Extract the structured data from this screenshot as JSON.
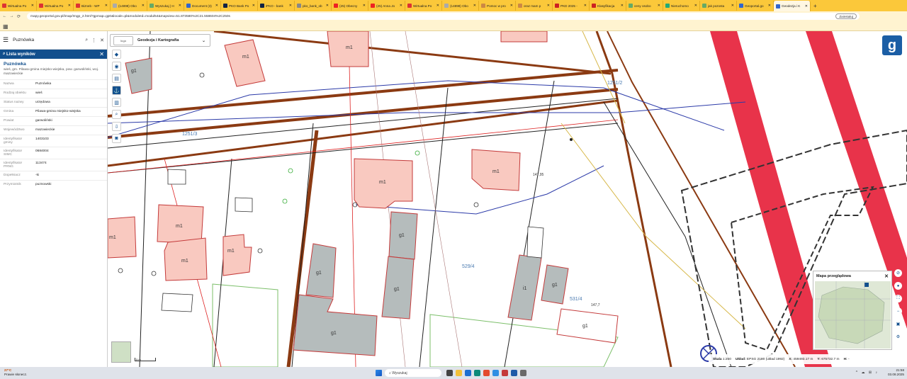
{
  "browser": {
    "tabs": [
      {
        "label": "Wirtualna Po",
        "color": "#d33"
      },
      {
        "label": "Wirtualna Po",
        "color": "#d33"
      },
      {
        "label": "Bizneb - WP",
        "color": "#d33"
      },
      {
        "label": "(14898) Obo",
        "color": "#aaa"
      },
      {
        "label": "Wyszukaj | H",
        "color": "#6a6"
      },
      {
        "label": "Document (3)",
        "color": "#36c"
      },
      {
        "label": "PKO Bank Po",
        "color": "#124"
      },
      {
        "label": "iPKO - bank",
        "color": "#124"
      },
      {
        "label": "pko_bank_ob",
        "color": "#888"
      },
      {
        "label": "(25) Obecny",
        "color": "#e22"
      },
      {
        "label": "(25) Anna Jo",
        "color": "#e22"
      },
      {
        "label": "Wirtualna Po",
        "color": "#d33"
      },
      {
        "label": "(14898) Obo",
        "color": "#aaa"
      },
      {
        "label": "Pomoc w pro",
        "color": "#c84"
      },
      {
        "label": "oraz mam p",
        "color": "#c84"
      },
      {
        "label": "PKD 2025 - ",
        "color": "#c22"
      },
      {
        "label": "Klasyfikacja",
        "color": "#c22"
      },
      {
        "label": "ceny osobo",
        "color": "#6a6"
      },
      {
        "label": "Nieruchomo",
        "color": "#2a7"
      },
      {
        "label": "jak pozosta",
        "color": "#6a6"
      },
      {
        "label": "Geoportal.go",
        "color": "#36c"
      },
      {
        "label": "Geodezja i K",
        "color": "#36c"
      }
    ],
    "active_tab": 21,
    "close_glyph": "✕",
    "new_tab_glyph": "+",
    "url": "mapy.geoportal.gov.pl/imap/Imgp_2.html?gpmap=gp0&locale=pl&moduleId=modul54&mapview=51.873580%2C21.558604%2C250s",
    "install_label": "Zainstaluj"
  },
  "left_panel": {
    "search_value": "Puznówka",
    "results_header": "Lista wyników",
    "object_name": "Puznówka",
    "object_desc": "wieś, gm. Pilawa-gmina miejsko-wiejska, pow. garwoliński, woj. mazowieckie",
    "attributes": [
      {
        "key": "Nazwa",
        "value": "Puznówka"
      },
      {
        "key": "Rodzaj obiektu",
        "value": "wieś"
      },
      {
        "key": "Status nazwy",
        "value": "urzędowa"
      },
      {
        "key": "Gmina",
        "value": "Pilawa-gmina miejsko-wiejska"
      },
      {
        "key": "Powiat",
        "value": "garwoliński"
      },
      {
        "key": "Województwo",
        "value": "mazowieckie"
      },
      {
        "key": "Identyfikator gminy",
        "value": "1403103"
      },
      {
        "key": "Identyfikator SIMC",
        "value": "0684004"
      },
      {
        "key": "Identyfikator PRNG",
        "value": "113474"
      },
      {
        "key": "Dopełniacz",
        "value": "-ki"
      },
      {
        "key": "Przymiotnik",
        "value": "puznowski"
      }
    ]
  },
  "toolbar": {
    "module_label": "Geodezja i Kartografia",
    "logo_text": "logo"
  },
  "map": {
    "labels": {
      "m1_a": "m1",
      "m1_b": "m1",
      "m1_c": "m1",
      "m1_d": "m1",
      "m1_e": "m1",
      "m1_f": "m1",
      "m1_g": "m1",
      "m1_h": "m1",
      "g1_a": "g1",
      "g1_b": "g1",
      "g1_c": "g1",
      "g1_d": "g1",
      "g1_e": "g1",
      "g1_f": "g1",
      "g1_g": "g1",
      "i1": "i1",
      "p1": "529/4",
      "p2": "531/4",
      "p3": "1251/3",
      "p4": "1251/2",
      "h1": "147,7",
      "h2": "147,95"
    },
    "colors": {
      "building_fill": "#f9c9c0",
      "building_stroke": "#c43a3a",
      "garage_fill": "#b5bcbc",
      "road_brown": "#8b3a12",
      "red_zone": "#e8334a",
      "pipe_blue": "#2b3aa8",
      "green_line": "#7cbf6a",
      "yellow_line": "#d7b84a"
    }
  },
  "overview": {
    "title": "Mapa przeglądowa"
  },
  "status": {
    "scale_label": "Skala",
    "scale_value": "1:250",
    "system_label": "Układ:",
    "system_value": "EPSG 2180 (układ 1992)",
    "x_label": "X:",
    "x_value": "459493.17 m",
    "y_label": "Y:",
    "y_value": "675732.7 m",
    "h_label": "H:",
    "h_value": "-"
  },
  "scalebar": {
    "label": "5 m"
  },
  "taskbar": {
    "temperature": "27°C",
    "weather_desc": "Prawie słonecz.",
    "search_placeholder": "Wyszukaj",
    "time": "21:58",
    "date": "03.08.2025"
  }
}
